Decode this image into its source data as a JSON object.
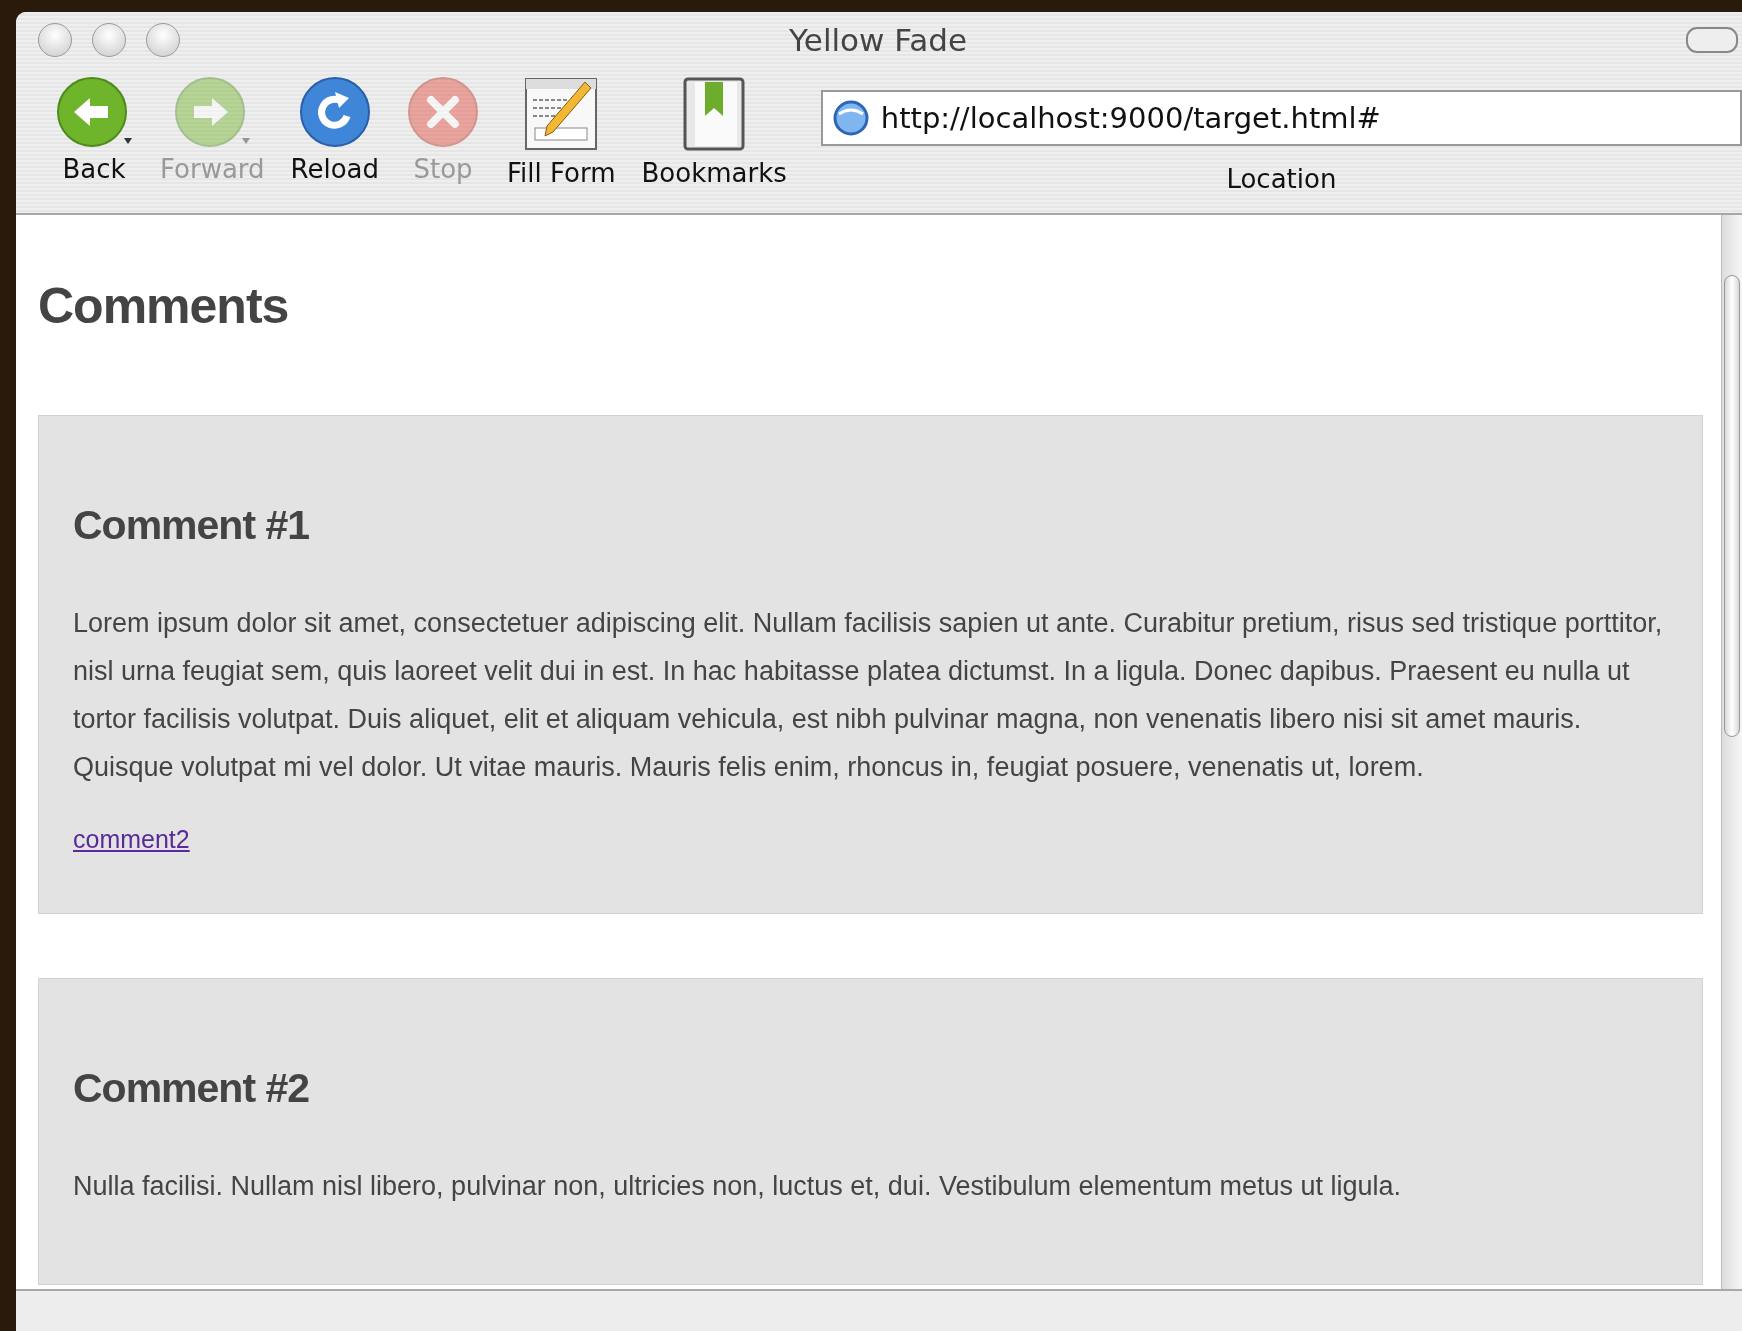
{
  "window": {
    "title": "Yellow Fade"
  },
  "toolbar": [
    {
      "label": "Back",
      "kind": "back",
      "disabled": false
    },
    {
      "label": "Forward",
      "kind": "forward",
      "disabled": true
    },
    {
      "label": "Reload",
      "kind": "reload",
      "disabled": false
    },
    {
      "label": "Stop",
      "kind": "stop",
      "disabled": true
    },
    {
      "label": "Fill Form",
      "kind": "fillform",
      "disabled": false
    },
    {
      "label": "Bookmarks",
      "kind": "bookmarks",
      "disabled": false
    }
  ],
  "location": {
    "value": "http://localhost:9000/target.html#",
    "label": "Location"
  },
  "page": {
    "heading": "Comments",
    "comments": [
      {
        "title": "Comment #1",
        "text": "Lorem ipsum dolor sit amet, consectetuer adipiscing elit. Nullam facilisis sapien ut ante. Curabitur pretium, risus sed tristique porttitor, nisl urna feugiat sem, quis laoreet velit dui in est. In hac habitasse platea dictumst. In a ligula. Donec dapibus. Praesent eu nulla ut tortor facilisis volutpat. Duis aliquet, elit et aliquam vehicula, est nibh pulvinar magna, non venenatis libero nisi sit amet mauris. Quisque volutpat mi vel dolor. Ut vitae mauris. Mauris felis enim, rhoncus in, feugiat posuere, venenatis ut, lorem.",
        "link": "comment2"
      },
      {
        "title": "Comment #2",
        "text": "Nulla facilisi. Nullam nisl libero, pulvinar non, ultricies non, luctus et, dui. Vestibulum elementum metus ut ligula."
      }
    ]
  }
}
